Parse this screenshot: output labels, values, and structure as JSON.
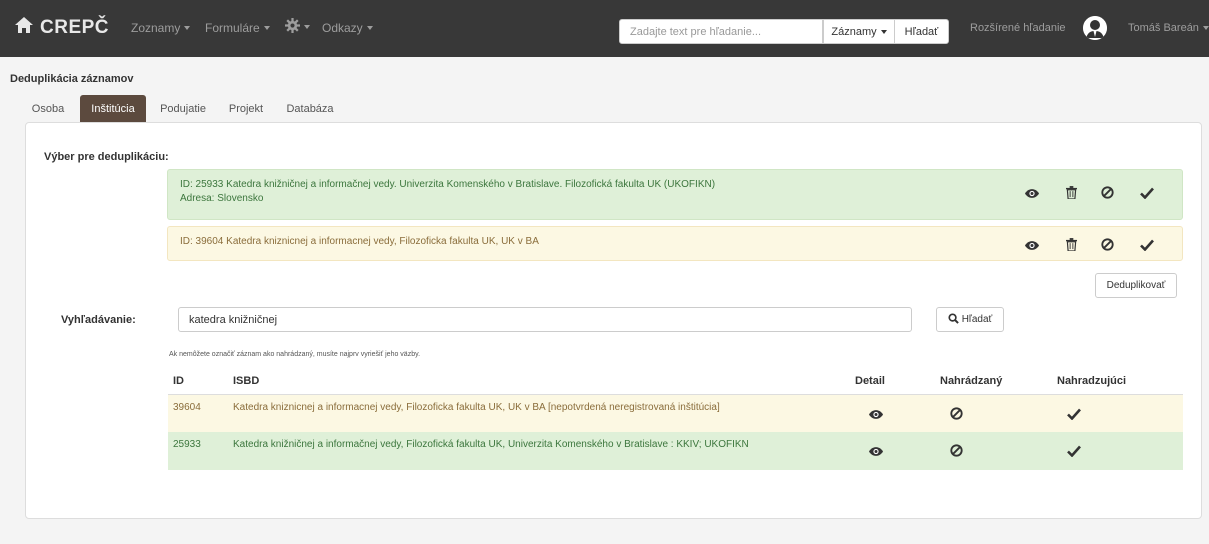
{
  "navbar": {
    "brand": "CREPČ",
    "menu": [
      {
        "label": "Zoznamy"
      },
      {
        "label": "Formuláre"
      },
      {
        "label": ""
      },
      {
        "label": "Odkazy"
      }
    ],
    "search_placeholder": "Zadajte text pre hľadanie...",
    "search_scope": "Záznamy",
    "search_button": "Hľadať",
    "advanced_search": "Rozšírené hľadanie",
    "user_name": "Tomáš Bareán"
  },
  "page": {
    "title": "Deduplikácia záznamov",
    "tabs": [
      {
        "label": "Osoba",
        "active": false
      },
      {
        "label": "Inštitúcia",
        "active": true
      },
      {
        "label": "Podujatie",
        "active": false
      },
      {
        "label": "Projekt",
        "active": false
      },
      {
        "label": "Databáza",
        "active": false
      }
    ]
  },
  "selection": {
    "label": "Výber pre deduplikáciu:",
    "items": [
      {
        "line1": "ID: 25933 Katedra knižničnej a informačnej vedy. Univerzita Komenského v Bratislave. Filozofická fakulta UK (UKOFIKN)",
        "line2": "Adresa: Slovensko",
        "status": "success"
      },
      {
        "line1": "ID: 39604 Katedra kniznicnej a informacnej vedy, Filozoficka fakulta UK, UK v BA",
        "line2": "",
        "status": "warning"
      }
    ],
    "deduplicate_button": "Deduplikovať"
  },
  "search": {
    "label": "Vyhľadávanie:",
    "query": "katedra knižničnej",
    "button": "Hľadať",
    "hint": "Ak nemôžete označiť záznam ako nahrádzaný, musíte najprv vyriešiť jeho väzby."
  },
  "results": {
    "headers": {
      "id": "ID",
      "isbd": "ISBD",
      "detail": "Detail",
      "replaced": "Nahrádzaný",
      "replacing": "Nahradzujúci"
    },
    "rows": [
      {
        "id": "39604",
        "isbd": "Katedra kniznicnej a informacnej vedy, Filozoficka fakulta UK, UK v BA [nepotvrdená neregistrovaná inštitúcia]",
        "status": "warning"
      },
      {
        "id": "25933",
        "isbd": "Katedra knižničnej a informačnej vedy, Filozofická fakulta UK, Univerzita Komenského v Bratislave : KKIV; UKOFIKN",
        "status": "success"
      }
    ]
  },
  "colors": {
    "navbar": "#383838",
    "active_tab": "#5c4a3e",
    "success_bg": "#dff0d8",
    "warning_bg": "#fcf8e3"
  },
  "icons": [
    "home-icon",
    "gear-icon",
    "user-avatar-icon",
    "eye-icon",
    "trash-icon",
    "ban-icon",
    "check-icon",
    "search-icon"
  ]
}
